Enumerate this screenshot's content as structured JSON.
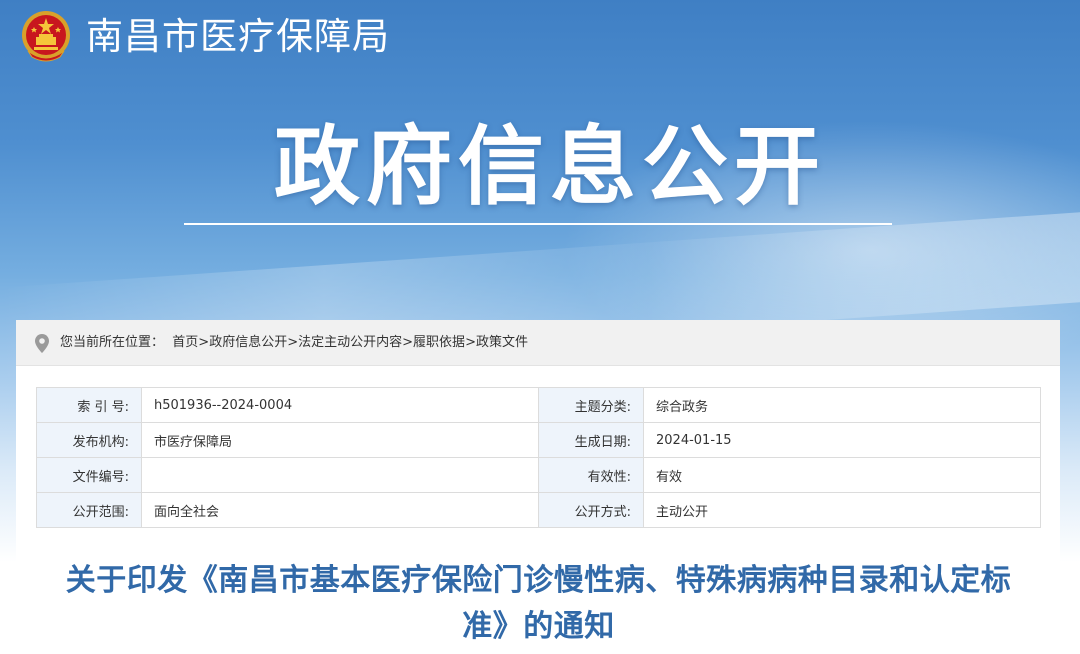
{
  "header": {
    "site_title": "南昌市医疗保障局",
    "emblem_icon": "national-emblem-icon",
    "hero_title": "政府信息公开"
  },
  "breadcrumb": {
    "prefix": "您当前所在位置：",
    "items": [
      "首页",
      "政府信息公开",
      "法定主动公开内容",
      "履职依据",
      "政策文件"
    ],
    "separator": ">"
  },
  "meta_table": {
    "rows": [
      [
        {
          "label": "索 引 号:",
          "value": "h501936--2024-0004"
        },
        {
          "label": "主题分类:",
          "value": "综合政务"
        }
      ],
      [
        {
          "label": "发布机构:",
          "value": "市医疗保障局"
        },
        {
          "label": "生成日期:",
          "value": "2024-01-15"
        }
      ],
      [
        {
          "label": "文件编号:",
          "value": ""
        },
        {
          "label": "有效性:",
          "value": "有效"
        }
      ],
      [
        {
          "label": "公开范围:",
          "value": "面向全社会"
        },
        {
          "label": "公开方式:",
          "value": "主动公开"
        }
      ]
    ]
  },
  "document": {
    "title_line1": "关于印发《南昌市基本医疗保险门诊慢性病、特殊病病种目录和认定标",
    "title_line2": "准》的通知"
  },
  "colors": {
    "banner_top": "#3f7fc4",
    "title_blue": "#3169a8",
    "label_bg": "#eef4fb",
    "crumb_bg": "#f1f1f1"
  }
}
